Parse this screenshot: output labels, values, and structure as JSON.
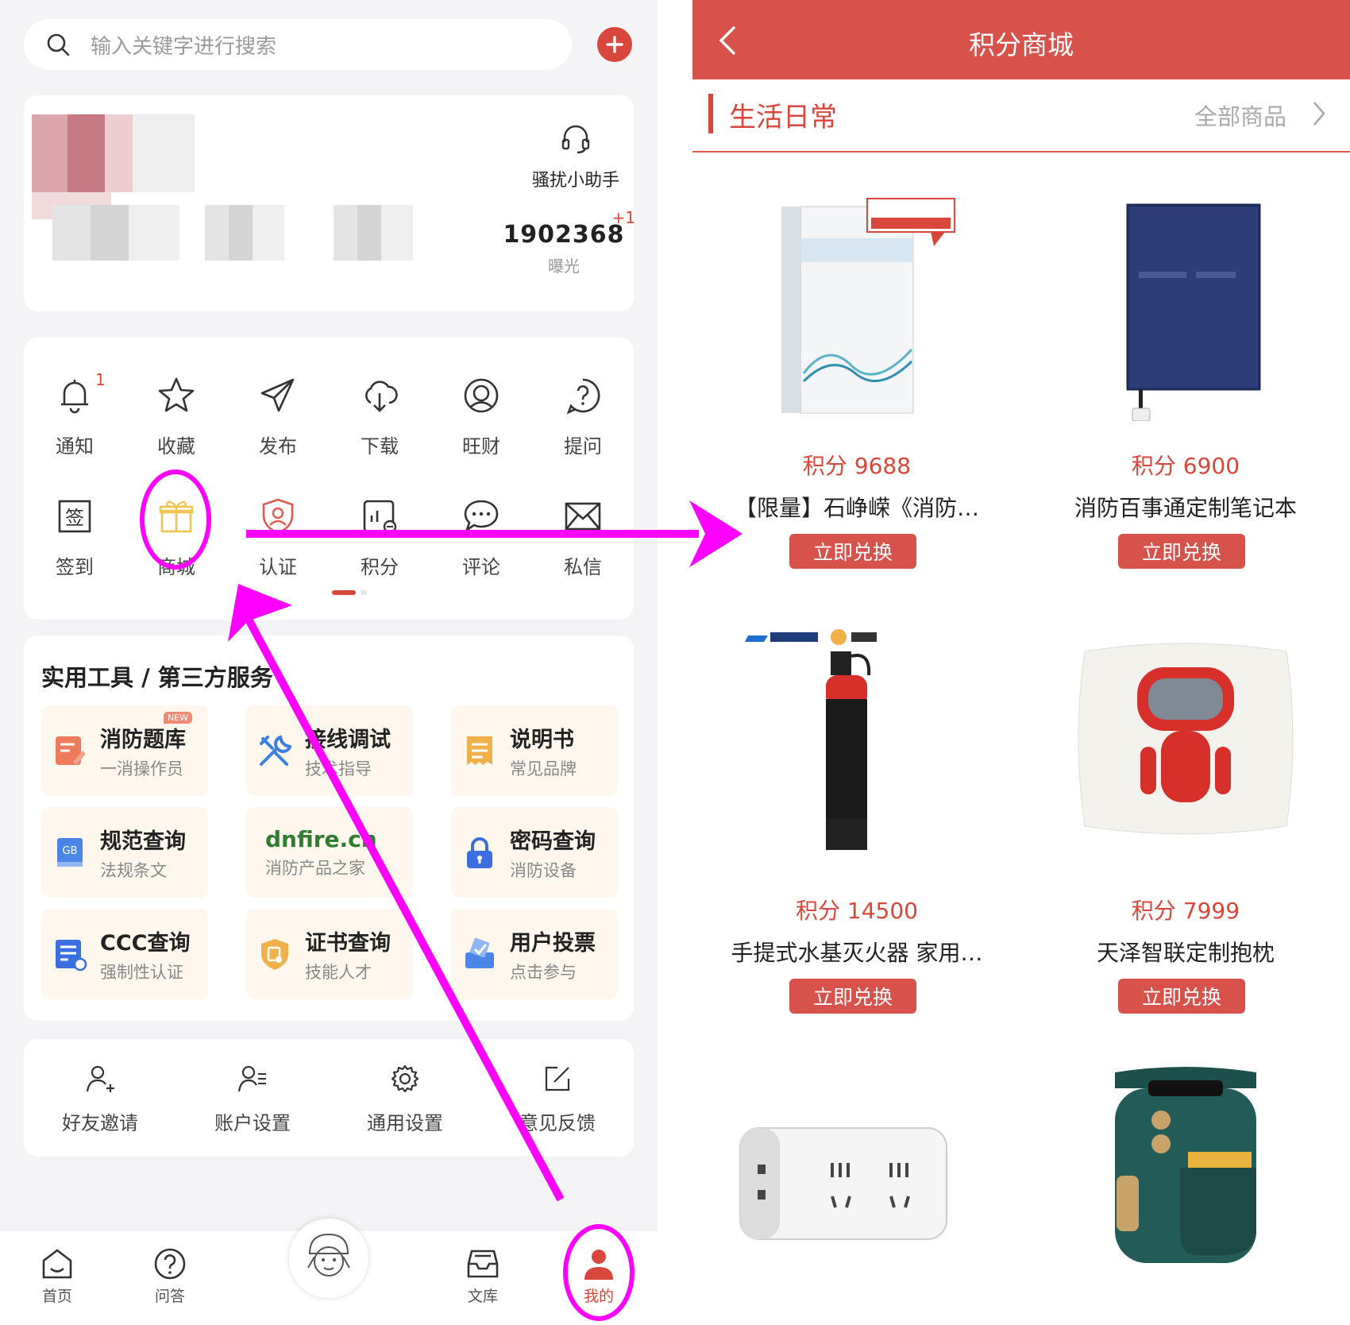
{
  "left": {
    "search": {
      "placeholder": "输入关键字进行搜索"
    },
    "profile": {
      "assistant_label": "骚扰小助手",
      "stat_value": "1902368",
      "stat_delta": "+1",
      "stat_label": "曝光"
    },
    "functions": [
      {
        "label": "通知",
        "icon": "bell-icon",
        "badge": "1"
      },
      {
        "label": "收藏",
        "icon": "star-icon"
      },
      {
        "label": "发布",
        "icon": "paper-plane-icon"
      },
      {
        "label": "下载",
        "icon": "cloud-download-icon"
      },
      {
        "label": "旺财",
        "icon": "coin-face-icon"
      },
      {
        "label": "提问",
        "icon": "question-icon"
      },
      {
        "label": "签到",
        "icon": "sign-in-icon"
      },
      {
        "label": "商城",
        "icon": "gift-icon"
      },
      {
        "label": "认证",
        "icon": "shield-user-icon"
      },
      {
        "label": "积分",
        "icon": "points-chart-icon"
      },
      {
        "label": "评论",
        "icon": "comment-icon"
      },
      {
        "label": "私信",
        "icon": "envelope-icon"
      }
    ],
    "tools": {
      "title": "实用工具 / 第三方服务",
      "items": [
        {
          "title": "消防题库",
          "sub": "一消操作员",
          "badge": "NEW",
          "icon": "quiz-icon"
        },
        {
          "title": "接线调试",
          "sub": "技术指导",
          "icon": "tools-icon"
        },
        {
          "title": "说明书",
          "sub": "常见品牌",
          "icon": "manual-icon"
        },
        {
          "title": "规范查询",
          "sub": "法规条文",
          "icon": "gb-book-icon"
        },
        {
          "title": "",
          "sub": "消防产品之家",
          "logo": "dnfire.cn",
          "icon": "dnfire-logo"
        },
        {
          "title": "密码查询",
          "sub": "消防设备",
          "icon": "lock-icon"
        },
        {
          "title": "CCC查询",
          "sub": "强制性认证",
          "icon": "certificate-doc-icon"
        },
        {
          "title": "证书查询",
          "sub": "技能人才",
          "icon": "badge-shield-icon"
        },
        {
          "title": "用户投票",
          "sub": "点击参与",
          "icon": "vote-box-icon"
        }
      ]
    },
    "settings": [
      {
        "label": "好友邀请",
        "icon": "add-user-icon"
      },
      {
        "label": "账户设置",
        "icon": "user-settings-icon"
      },
      {
        "label": "通用设置",
        "icon": "gear-icon"
      },
      {
        "label": "意见反馈",
        "icon": "edit-icon"
      }
    ],
    "tabs": [
      {
        "label": "首页",
        "icon": "home-icon"
      },
      {
        "label": "问答",
        "icon": "question-icon"
      },
      {
        "label": "文库",
        "icon": "inbox-icon"
      },
      {
        "label": "我的",
        "icon": "user-icon",
        "active": true
      }
    ]
  },
  "right": {
    "header_title": "积分商城",
    "section": {
      "name": "生活日常",
      "all_label": "全部商品"
    },
    "products": [
      {
        "price": "积分 9688",
        "name": "【限量】石峥嵘《消防…",
        "button": "立即兑换",
        "image": "book-cover"
      },
      {
        "price": "积分 6900",
        "name": "消防百事通定制笔记本",
        "button": "立即兑换",
        "image": "notebook"
      },
      {
        "price": "积分 14500",
        "name": "手提式水基灭火器 家用…",
        "button": "立即兑换",
        "image": "fire-extinguisher"
      },
      {
        "price": "积分 7999",
        "name": "天泽智联定制抱枕",
        "button": "立即兑换",
        "image": "robot-pillow"
      },
      {
        "image": "power-socket"
      },
      {
        "image": "air-fryer"
      }
    ]
  },
  "colors": {
    "accent": "#d9463b",
    "header": "#d6524a",
    "annotation": "#ff00ff"
  }
}
